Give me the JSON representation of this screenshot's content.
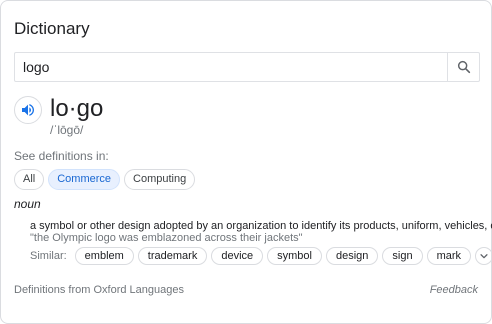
{
  "card": {
    "title": "Dictionary",
    "search": {
      "value": "logo",
      "icon": "search-icon"
    },
    "entry": {
      "word": "lo·go",
      "phonetic": "/ˈlōɡō/",
      "speaker_icon": "speaker-icon"
    },
    "definitions_label": "See definitions in:",
    "domains": [
      {
        "label": "All",
        "selected": false
      },
      {
        "label": "Commerce",
        "selected": true
      },
      {
        "label": "Computing",
        "selected": false
      }
    ],
    "part_of_speech": "noun",
    "definition": "a symbol or other design adopted by an organization to identify its products, uniform, vehicles, etc.",
    "example": "\"the Olympic logo was emblazoned across their jackets\"",
    "similar_label": "Similar:",
    "similar": [
      "emblem",
      "trademark",
      "device",
      "symbol",
      "design",
      "sign",
      "mark"
    ],
    "expand_icon": "chevron-down-icon",
    "source": "Definitions from Oxford Languages",
    "feedback": "Feedback"
  },
  "colors": {
    "accent": "#1a73e8",
    "selected_chip_bg": "#e8f0fe",
    "muted_text": "#70757a",
    "border": "#dadce0"
  }
}
